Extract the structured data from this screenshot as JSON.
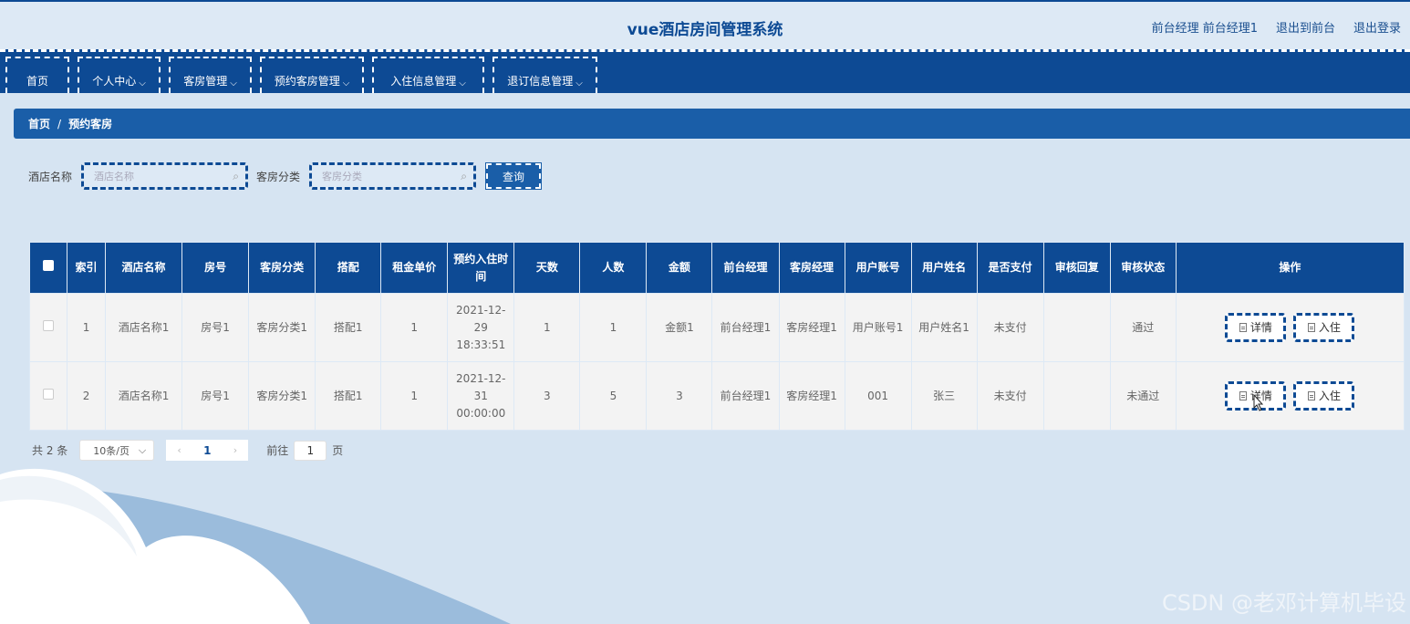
{
  "header": {
    "title": "vue酒店房间管理系统",
    "user_role": "前台经理 前台经理1",
    "to_front_label": "退出到前台",
    "logout_label": "退出登录"
  },
  "nav": {
    "items": [
      {
        "label": "首页",
        "dropdown": false
      },
      {
        "label": "个人中心",
        "dropdown": true
      },
      {
        "label": "客房管理",
        "dropdown": true
      },
      {
        "label": "预约客房管理",
        "dropdown": true
      },
      {
        "label": "入住信息管理",
        "dropdown": true
      },
      {
        "label": "退订信息管理",
        "dropdown": true
      }
    ]
  },
  "breadcrumb": {
    "home": "首页",
    "separator": "/",
    "current": "预约客房"
  },
  "search": {
    "hotel_label": "酒店名称",
    "hotel_placeholder": "酒店名称",
    "category_label": "客房分类",
    "category_placeholder": "客房分类",
    "query_label": "查询"
  },
  "table": {
    "headers": [
      "索引",
      "酒店名称",
      "房号",
      "客房分类",
      "搭配",
      "租金单价",
      "预约入住时间",
      "天数",
      "人数",
      "金额",
      "前台经理",
      "客房经理",
      "用户账号",
      "用户姓名",
      "是否支付",
      "审核回复",
      "审核状态",
      "操作"
    ],
    "rows": [
      {
        "index": "1",
        "hotel": "酒店名称1",
        "room": "房号1",
        "category": "客房分类1",
        "combo": "搭配1",
        "price": "1",
        "time": "2021-12-29 18:33:51",
        "days": "1",
        "people": "1",
        "amount": "金额1",
        "front_manager": "前台经理1",
        "room_manager": "客房经理1",
        "account": "用户账号1",
        "name": "用户姓名1",
        "paid": "未支付",
        "reply": "",
        "status": "通过"
      },
      {
        "index": "2",
        "hotel": "酒店名称1",
        "room": "房号1",
        "category": "客房分类1",
        "combo": "搭配1",
        "price": "1",
        "time": "2021-12-31 00:00:00",
        "days": "3",
        "people": "5",
        "amount": "3",
        "front_manager": "前台经理1",
        "room_manager": "客房经理1",
        "account": "001",
        "name": "张三",
        "paid": "未支付",
        "reply": "",
        "status": "未通过"
      }
    ],
    "detail_label": "详情",
    "checkin_label": "入住"
  },
  "pagination": {
    "total_text": "共 2 条",
    "page_size": "10条/页",
    "current_page": "1",
    "goto_prefix": "前往",
    "goto_value": "1",
    "goto_suffix": "页"
  },
  "watermark": "CSDN @老邓计算机毕设",
  "colors": {
    "primary": "#0d4a94",
    "accent": "#1a5ea8",
    "background": "#d6e4f2"
  }
}
